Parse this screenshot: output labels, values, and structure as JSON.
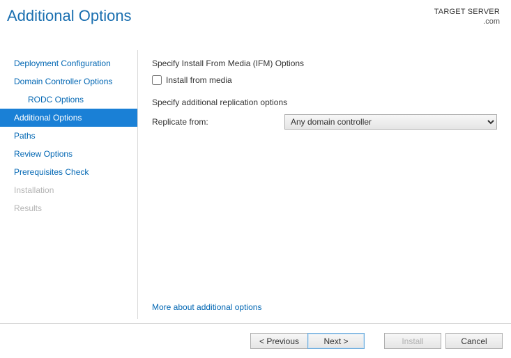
{
  "header": {
    "title": "Additional Options",
    "target_label": "TARGET SERVER",
    "target_value": ".com"
  },
  "sidebar": {
    "items": [
      {
        "label": "Deployment Configuration",
        "indent": false,
        "active": false,
        "disabled": false
      },
      {
        "label": "Domain Controller Options",
        "indent": false,
        "active": false,
        "disabled": false
      },
      {
        "label": "RODC Options",
        "indent": true,
        "active": false,
        "disabled": false
      },
      {
        "label": "Additional Options",
        "indent": false,
        "active": true,
        "disabled": false
      },
      {
        "label": "Paths",
        "indent": false,
        "active": false,
        "disabled": false
      },
      {
        "label": "Review Options",
        "indent": false,
        "active": false,
        "disabled": false
      },
      {
        "label": "Prerequisites Check",
        "indent": false,
        "active": false,
        "disabled": false
      },
      {
        "label": "Installation",
        "indent": false,
        "active": false,
        "disabled": true
      },
      {
        "label": "Results",
        "indent": false,
        "active": false,
        "disabled": true
      }
    ]
  },
  "content": {
    "ifm_heading": "Specify Install From Media (IFM) Options",
    "ifm_checkbox_label": "Install from media",
    "ifm_checked": false,
    "repl_heading": "Specify additional replication options",
    "repl_label": "Replicate from:",
    "repl_selected": "Any domain controller",
    "more_link": "More about additional options"
  },
  "footer": {
    "previous": "< Previous",
    "next": "Next >",
    "install": "Install",
    "cancel": "Cancel"
  }
}
